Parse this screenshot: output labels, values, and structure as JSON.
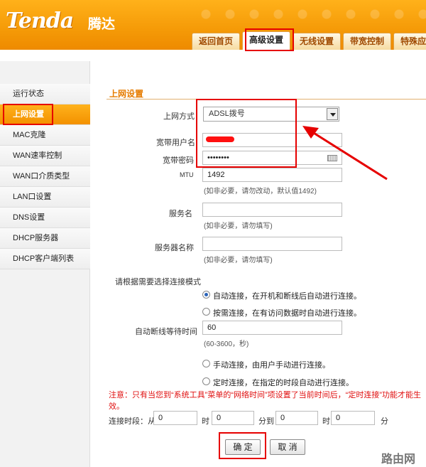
{
  "header": {
    "logo": "Tenda",
    "logo_cn": "腾达",
    "tabs": [
      "返回首页",
      "高级设置",
      "无线设置",
      "带宽控制",
      "特殊应"
    ],
    "active_tab": "高级设置"
  },
  "sidebar": {
    "items": [
      "运行状态",
      "上网设置",
      "MAC克隆",
      "WAN速率控制",
      "WAN口介质类型",
      "LAN口设置",
      "DNS设置",
      "DHCP服务器",
      "DHCP客户端列表"
    ],
    "active": "上网设置"
  },
  "form": {
    "section_title": "上网设置",
    "connection_type_label": "上网方式",
    "connection_type_value": "ADSL拨号",
    "username_label": "宽带用户名",
    "password_label": "宽带密码",
    "password_value": "••••••••",
    "mtu_label": "MTU",
    "mtu_value": "1492",
    "mtu_hint": "(如非必要，请勿改动，默认值1492)",
    "service_name_label": "服务名",
    "service_name_hint": "(如非必要，请勿填写)",
    "server_name_label": "服务器名称",
    "server_name_hint": "(如非必要，请勿填写)",
    "connect_mode_label": "请根据需要选择连接模式",
    "radio_auto": "自动连接，在开机和断线后自动进行连接。",
    "radio_demand": "按需连接，在有访问数据时自动进行连接。",
    "idle_wait_label": "自动断线等待时间",
    "idle_wait_value": "60",
    "idle_wait_hint": "(60-3600，秒)",
    "radio_manual": "手动连接，由用户手动进行连接。",
    "radio_timed": "定时连接，在指定的时段自动进行连接。",
    "note": "注意：只有当您到“系统工具”菜单的“网络时间”项设置了当前时间后，“定时连接”功能才能生效。",
    "period_label": "连接时段：从",
    "hour_1": "0",
    "hour_unit_1": "时",
    "minute_1": "0",
    "to_label": "分到",
    "hour_2": "0",
    "hour_unit_2": "时",
    "minute_2": "0",
    "minute_unit": "分",
    "ok_label": "确 定",
    "cancel_label": "取 消"
  },
  "watermark": "路由网",
  "colors": {
    "accent": "#f39100",
    "highlight": "#e60000"
  }
}
